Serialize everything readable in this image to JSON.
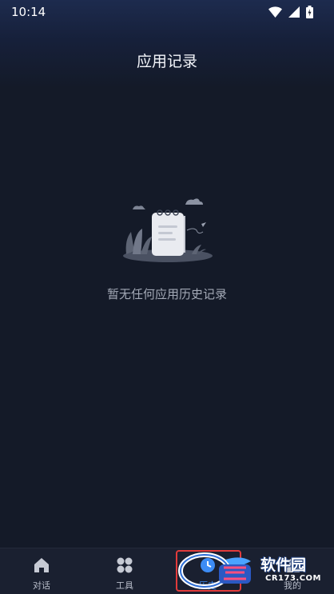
{
  "status_bar": {
    "time": "10:14",
    "icons": [
      "wifi-icon",
      "cellular-signal-icon",
      "battery-charging-icon"
    ]
  },
  "header": {
    "title": "应用记录"
  },
  "empty_state": {
    "illustration": "empty-notebook-illustration",
    "message": "暂无任何应用历史记录"
  },
  "bottom_nav": {
    "active_index": 2,
    "active_color": "#3d8cf5",
    "items": [
      {
        "label": "对话",
        "icon": "home-icon"
      },
      {
        "label": "工具",
        "icon": "tools-grid-icon"
      },
      {
        "label": "历史",
        "icon": "history-icon"
      },
      {
        "label": "我的",
        "icon": "profile-icon"
      }
    ]
  },
  "watermark": {
    "logo_text": "CR",
    "brand": "软件园",
    "site": "CR173.COM"
  },
  "colors": {
    "background": "#141a28",
    "highlight_box": "#e23b3b"
  }
}
